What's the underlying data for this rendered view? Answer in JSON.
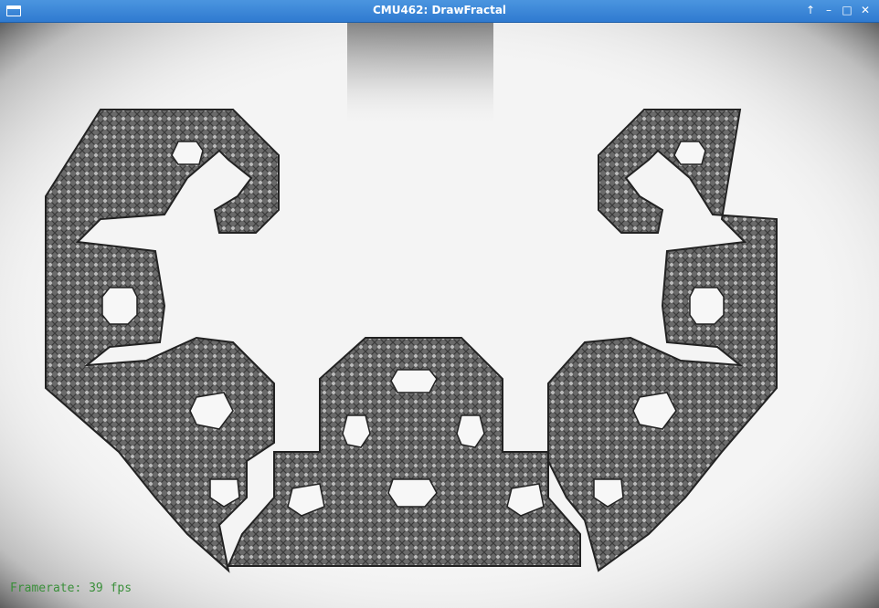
{
  "window": {
    "title": "CMU462: DrawFractal"
  },
  "controls": {
    "up": "↑",
    "minimize": "–",
    "maximize": "□",
    "close": "✕"
  },
  "status": {
    "framerate": "Framerate: 39 fps"
  }
}
